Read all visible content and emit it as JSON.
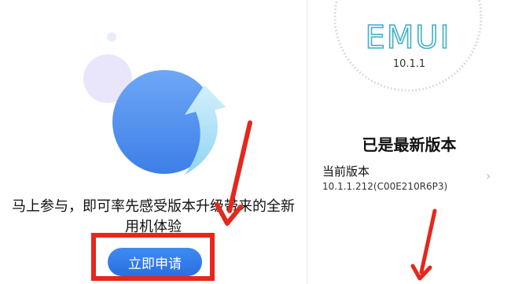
{
  "left_panel": {
    "notice_line1": "马上参与，即可率先感受版本升级带来的全新",
    "notice_line2": "用机体验",
    "apply_button_label": "立即申请"
  },
  "right_panel": {
    "logo_text": "EMUI",
    "version_number": "10.1.1",
    "status_title": "已是最新版本",
    "current_version_label": "当前版本",
    "current_version_value": "10.1.1.212(C00E210R6P3)",
    "chevron_icon": "chevron-right-icon"
  },
  "colors": {
    "primary_blue": "#2f7bea",
    "annotation_red": "#e4281c",
    "logo_teal": "#3fb0c8"
  }
}
